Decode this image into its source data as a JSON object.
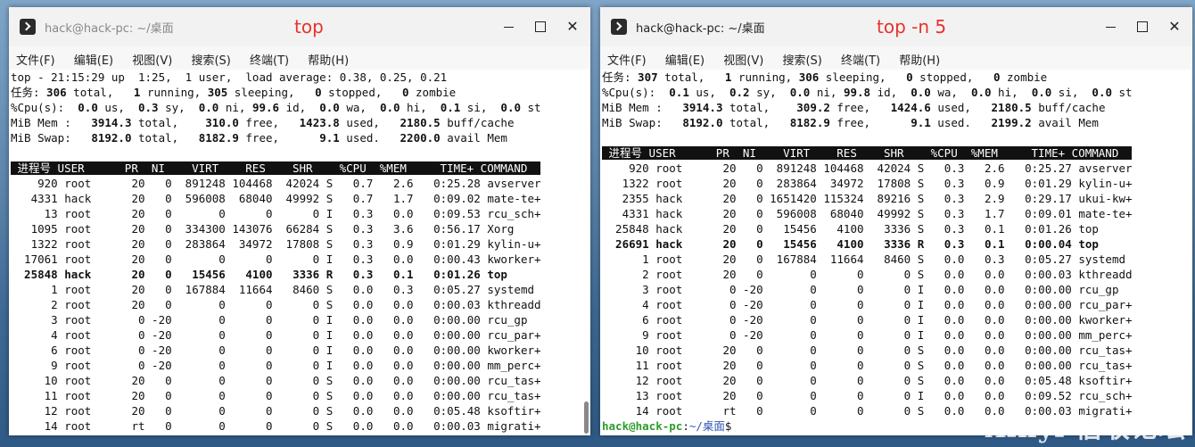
{
  "desktop": {
    "watermark": "Xinyi 信收论坛"
  },
  "win1": {
    "title": "hack@hack-pc: ~/桌面",
    "annotation": "top",
    "menu": [
      "文件(F)",
      "编辑(E)",
      "视图(V)",
      "搜索(S)",
      "终端(T)",
      "帮助(H)"
    ],
    "lines": [
      [
        "top - 21:15:29 up  1:25,  1 user,  load average: 0.38, 0.25, 0.21"
      ],
      [
        "任务:",
        {
          "b": " 306"
        },
        " total,   ",
        {
          "b": "1"
        },
        " running, ",
        {
          "b": "305"
        },
        " sleeping,   ",
        {
          "b": "0"
        },
        " stopped,   ",
        {
          "b": "0"
        },
        " zombie"
      ],
      [
        "%Cpu(s):  ",
        {
          "b": "0.0"
        },
        " us,  ",
        {
          "b": "0.3"
        },
        " sy,  ",
        {
          "b": "0.0"
        },
        " ni, ",
        {
          "b": "99.6"
        },
        " id,  ",
        {
          "b": "0.0"
        },
        " wa,  ",
        {
          "b": "0.0"
        },
        " hi,  ",
        {
          "b": "0.1"
        },
        " si,  ",
        {
          "b": "0.0"
        },
        " st"
      ],
      [
        "MiB Mem :   ",
        {
          "b": "3914.3"
        },
        " total,    ",
        {
          "b": "310.0"
        },
        " free,   ",
        {
          "b": "1423.8"
        },
        " used,   ",
        {
          "b": "2180.5"
        },
        " buff/cache"
      ],
      [
        "MiB Swap:   ",
        {
          "b": "8192.0"
        },
        " total,   ",
        {
          "b": "8182.9"
        },
        " free,      ",
        {
          "b": "9.1"
        },
        " used.   ",
        {
          "b": "2200.0"
        },
        " avail Mem"
      ],
      [
        ""
      ],
      [
        {
          "h": " 进程号 USER      PR  NI    VIRT    RES    SHR    %CPU  %MEM     TIME+ COMMAND  "
        }
      ],
      [
        "    920 root      20   0  891248 104468  42024 S   0.7   2.6   0:25.28 avserver"
      ],
      [
        "   4331 hack      20   0  596008  68040  49992 S   0.7   1.7   0:09.02 mate-te+"
      ],
      [
        "     13 root      20   0       0      0      0 I   0.3   0.0   0:09.53 rcu_sch+"
      ],
      [
        "   1095 root      20   0  334300 143076  66284 S   0.3   3.6   0:56.17 Xorg"
      ],
      [
        "   1322 root      20   0  283864  34972  17808 S   0.3   0.9   0:01.29 kylin-u+"
      ],
      [
        "  17061 root      20   0       0      0      0 I   0.3   0.0   0:00.43 kworker+"
      ],
      [
        {
          "b": "  25848 hack      20   0   15456   4100   3336 R   0.3   0.1   0:01.26 top"
        }
      ],
      [
        "      1 root      20   0  167884  11664   8460 S   0.0   0.3   0:05.27 systemd"
      ],
      [
        "      2 root      20   0       0      0      0 S   0.0   0.0   0:00.03 kthreadd"
      ],
      [
        "      3 root       0 -20       0      0      0 I   0.0   0.0   0:00.00 rcu_gp"
      ],
      [
        "      4 root       0 -20       0      0      0 I   0.0   0.0   0:00.00 rcu_par+"
      ],
      [
        "      6 root       0 -20       0      0      0 I   0.0   0.0   0:00.00 kworker+"
      ],
      [
        "      9 root       0 -20       0      0      0 I   0.0   0.0   0:00.00 mm_perc+"
      ],
      [
        "     10 root      20   0       0      0      0 S   0.0   0.0   0:00.00 rcu_tas+"
      ],
      [
        "     11 root      20   0       0      0      0 S   0.0   0.0   0:00.00 rcu_tas+"
      ],
      [
        "     12 root      20   0       0      0      0 S   0.0   0.0   0:05.48 ksoftir+"
      ],
      [
        "     14 root      rt   0       0      0      0 S   0.0   0.0   0:00.03 migrati+"
      ]
    ]
  },
  "win2": {
    "title": "hack@hack-pc: ~/桌面",
    "annotation": "top -n 5",
    "menu": [
      "文件(F)",
      "编辑(E)",
      "视图(V)",
      "搜索(S)",
      "终端(T)",
      "帮助(H)"
    ],
    "lines": [
      [
        "任务:",
        {
          "b": " 307"
        },
        " total,   ",
        {
          "b": "1"
        },
        " running, ",
        {
          "b": "306"
        },
        " sleeping,   ",
        {
          "b": "0"
        },
        " stopped,   ",
        {
          "b": "0"
        },
        " zombie"
      ],
      [
        "%Cpu(s):  ",
        {
          "b": "0.1"
        },
        " us,  ",
        {
          "b": "0.2"
        },
        " sy,  ",
        {
          "b": "0.0"
        },
        " ni, ",
        {
          "b": "99.8"
        },
        " id,  ",
        {
          "b": "0.0"
        },
        " wa,  ",
        {
          "b": "0.0"
        },
        " hi,  ",
        {
          "b": "0.0"
        },
        " si,  ",
        {
          "b": "0.0"
        },
        " st"
      ],
      [
        "MiB Mem :   ",
        {
          "b": "3914.3"
        },
        " total,    ",
        {
          "b": "309.2"
        },
        " free,   ",
        {
          "b": "1424.6"
        },
        " used,   ",
        {
          "b": "2180.5"
        },
        " buff/cache"
      ],
      [
        "MiB Swap:   ",
        {
          "b": "8192.0"
        },
        " total,   ",
        {
          "b": "8182.9"
        },
        " free,      ",
        {
          "b": "9.1"
        },
        " used.   ",
        {
          "b": "2199.2"
        },
        " avail Mem"
      ],
      [
        ""
      ],
      [
        {
          "h": " 进程号 USER      PR  NI    VIRT    RES    SHR    %CPU  %MEM     TIME+ COMMAND  "
        }
      ],
      [
        "    920 root      20   0  891248 104468  42024 S   0.3   2.6   0:25.27 avserver"
      ],
      [
        "   1322 root      20   0  283864  34972  17808 S   0.3   0.9   0:01.29 kylin-u+"
      ],
      [
        "   2355 hack      20   0 1651420 115324  89216 S   0.3   2.9   0:29.17 ukui-kw+"
      ],
      [
        "   4331 hack      20   0  596008  68040  49992 S   0.3   1.7   0:09.01 mate-te+"
      ],
      [
        "  25848 hack      20   0   15456   4100   3336 S   0.3   0.1   0:01.26 top"
      ],
      [
        {
          "b": "  26691 hack      20   0   15456   4100   3336 R   0.3   0.1   0:00.04 top"
        }
      ],
      [
        "      1 root      20   0  167884  11664   8460 S   0.0   0.3   0:05.27 systemd"
      ],
      [
        "      2 root      20   0       0      0      0 S   0.0   0.0   0:00.03 kthreadd"
      ],
      [
        "      3 root       0 -20       0      0      0 I   0.0   0.0   0:00.00 rcu_gp"
      ],
      [
        "      4 root       0 -20       0      0      0 I   0.0   0.0   0:00.00 rcu_par+"
      ],
      [
        "      6 root       0 -20       0      0      0 I   0.0   0.0   0:00.00 kworker+"
      ],
      [
        "      9 root       0 -20       0      0      0 I   0.0   0.0   0:00.00 mm_perc+"
      ],
      [
        "     10 root      20   0       0      0      0 S   0.0   0.0   0:00.00 rcu_tas+"
      ],
      [
        "     11 root      20   0       0      0      0 S   0.0   0.0   0:00.00 rcu_tas+"
      ],
      [
        "     12 root      20   0       0      0      0 S   0.0   0.0   0:05.48 ksoftir+"
      ],
      [
        "     13 root      20   0       0      0      0 I   0.0   0.0   0:09.52 rcu_sch+"
      ],
      [
        "     14 root      rt   0       0      0      0 S   0.0   0.0   0:00.03 migrati+"
      ]
    ],
    "prompt": {
      "user": "hack@hack-pc",
      "sep": ":",
      "path": "~/桌面",
      "sym": "$"
    }
  }
}
